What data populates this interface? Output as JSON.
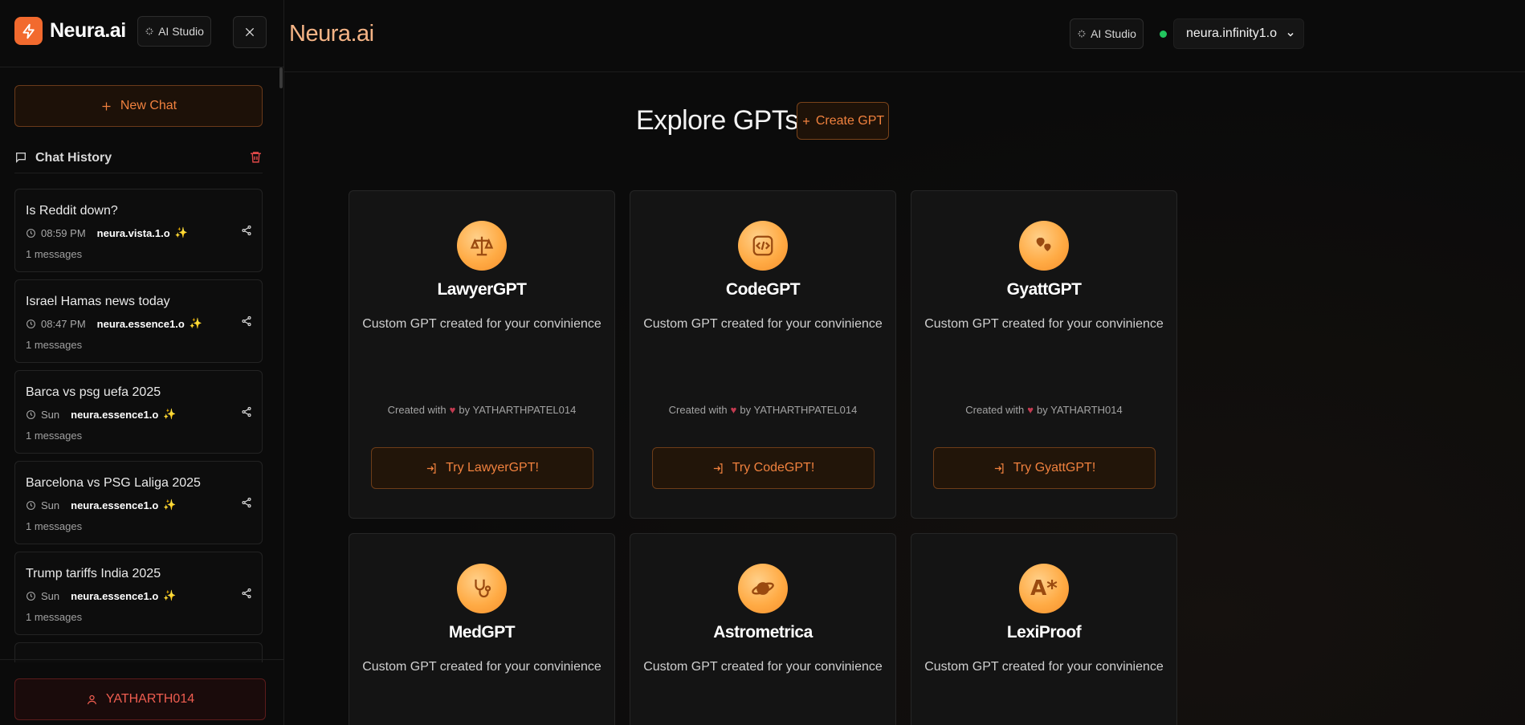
{
  "sidebar": {
    "logo_text": "Neura.ai",
    "studio_label": "AI Studio",
    "new_chat_label": "New Chat",
    "history_title": "Chat History",
    "chats": [
      {
        "title": "Is Reddit down?",
        "time": "08:59 PM",
        "model": "neura.vista.1.o",
        "count": "1 messages"
      },
      {
        "title": "Israel Hamas news today",
        "time": "08:47 PM",
        "model": "neura.essence1.o",
        "count": "1 messages"
      },
      {
        "title": "Barca vs psg uefa 2025",
        "time": "Sun",
        "model": "neura.essence1.o",
        "count": "1 messages"
      },
      {
        "title": "Barcelona vs PSG Laliga 2025",
        "time": "Sun",
        "model": "neura.essence1.o",
        "count": "1 messages"
      },
      {
        "title": "Trump tariffs India 2025",
        "time": "Sun",
        "model": "neura.essence1.o",
        "count": "1 messages"
      }
    ],
    "user_label": "YATHARTH014"
  },
  "header": {
    "brand": "Neura.ai",
    "studio_label": "AI Studio",
    "model_selected": "neura.infinity1.o"
  },
  "main": {
    "title": "Explore GPTs",
    "create_label": "Create GPT",
    "cards": [
      {
        "name": "LawyerGPT",
        "desc": "Custom GPT created for your convinience",
        "credit_prefix": "Created with",
        "credit_by": "by YATHARTHPATEL014",
        "try_label": "Try LawyerGPT!",
        "icon": "scale-icon"
      },
      {
        "name": "CodeGPT",
        "desc": "Custom GPT created for your convinience",
        "credit_prefix": "Created with",
        "credit_by": "by YATHARTHPATEL014",
        "try_label": "Try CodeGPT!",
        "icon": "code-icon"
      },
      {
        "name": "GyattGPT",
        "desc": "Custom GPT created for your convinience",
        "credit_prefix": "Created with",
        "credit_by": "by YATHARTH014",
        "try_label": "Try GyattGPT!",
        "icon": "hearts-icon"
      },
      {
        "name": "MedGPT",
        "desc": "Custom GPT created for your convinience",
        "icon": "stethoscope-icon"
      },
      {
        "name": "Astrometrica",
        "desc": "Custom GPT created for your convinience",
        "icon": "planet-icon"
      },
      {
        "name": "LexiProof",
        "desc": "Custom GPT created for your convinience",
        "icon": "text-a-icon"
      }
    ]
  },
  "colors": {
    "accent": "#f26a2e",
    "accent_text": "#f0813e",
    "status_online": "#22c55e",
    "danger": "#ef5d50"
  }
}
